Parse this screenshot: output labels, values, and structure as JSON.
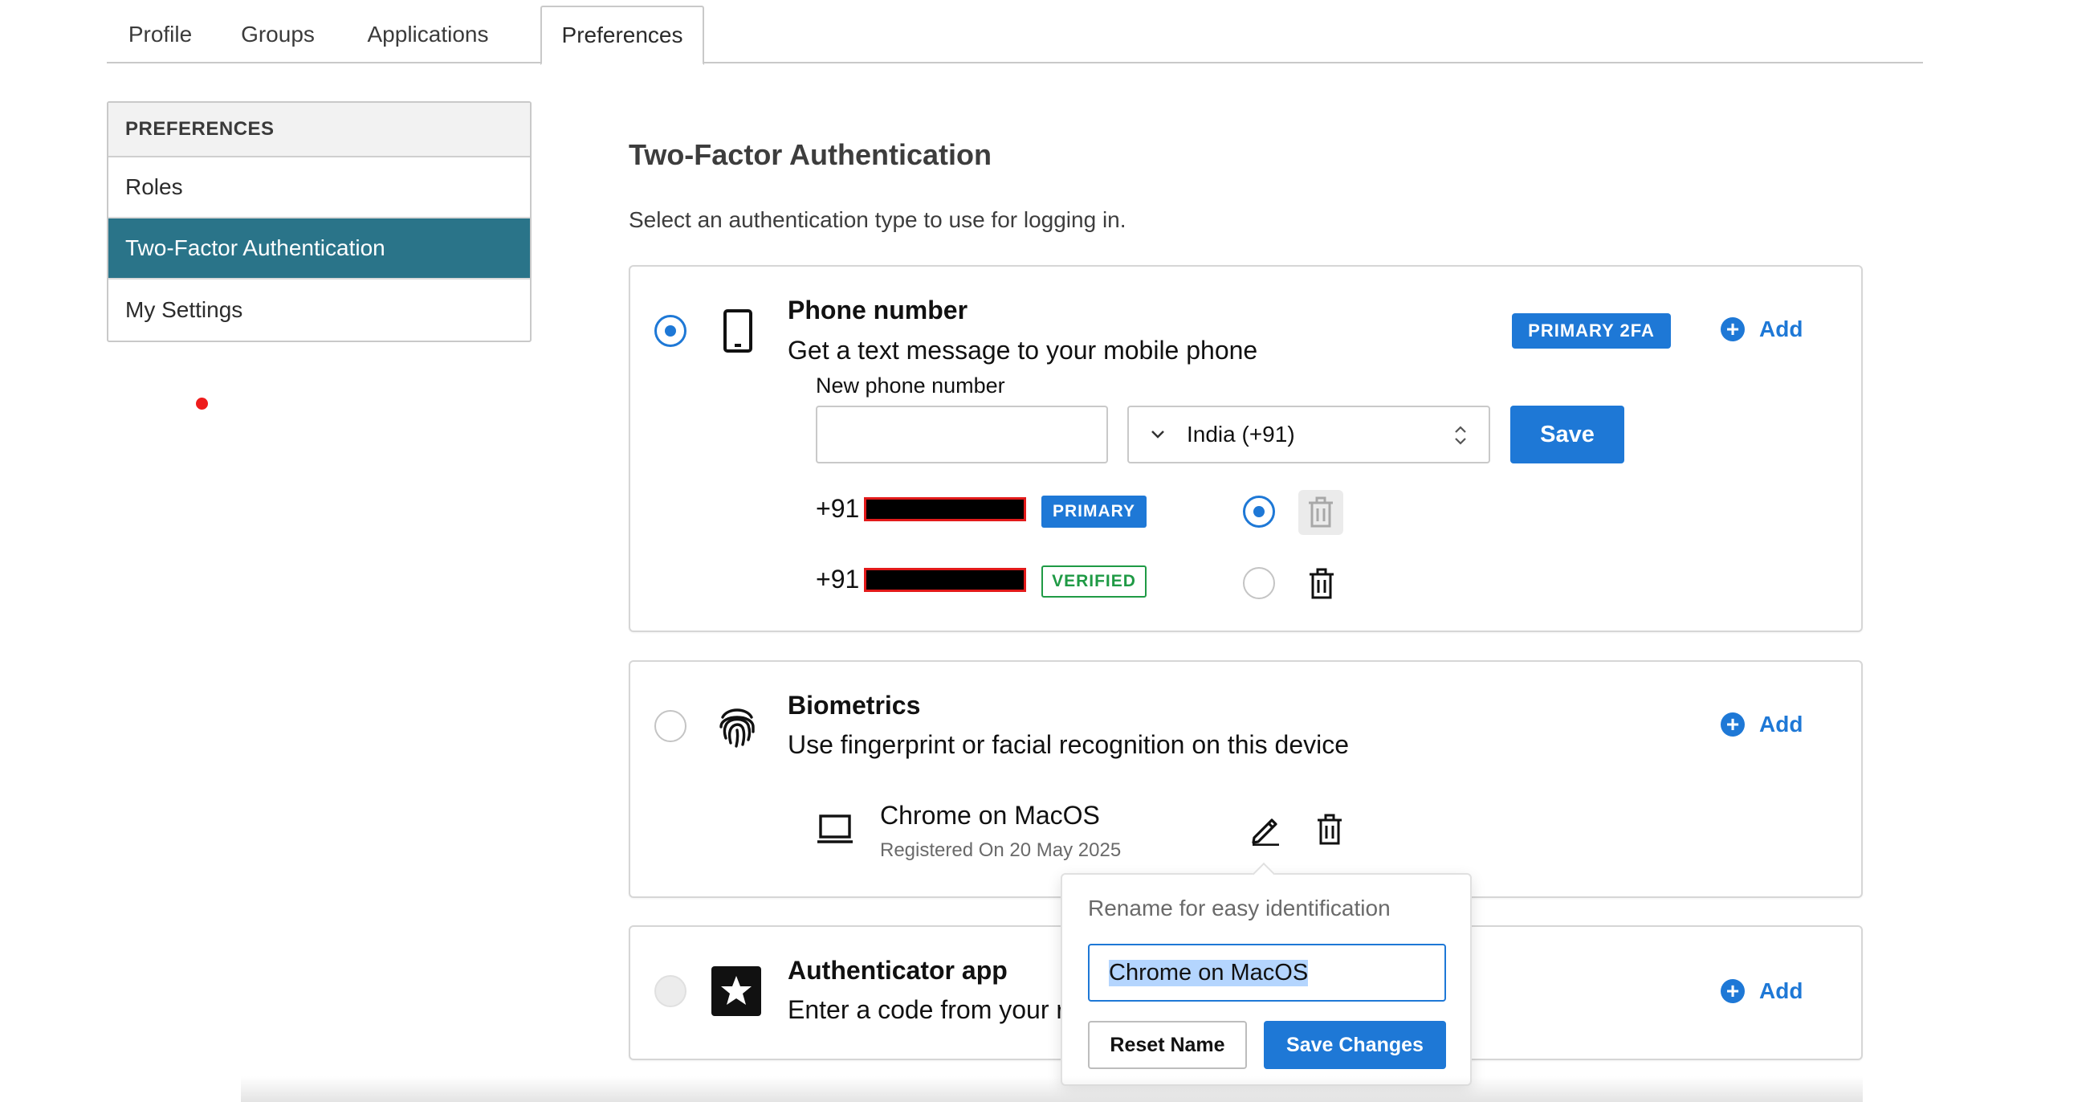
{
  "tabs": [
    {
      "label": "Profile"
    },
    {
      "label": "Groups"
    },
    {
      "label": "Applications"
    },
    {
      "label": "Preferences"
    }
  ],
  "sidebar": {
    "heading": "PREFERENCES",
    "items": [
      {
        "label": "Roles"
      },
      {
        "label": "Two-Factor Authentication"
      },
      {
        "label": "My Settings"
      }
    ]
  },
  "main": {
    "title": "Two-Factor Authentication",
    "subtitle": "Select an authentication type to use for logging in."
  },
  "phone": {
    "title": "Phone number",
    "description": "Get a text message to your mobile phone",
    "badge": "PRIMARY 2FA",
    "add_label": "Add",
    "new_label": "New phone number",
    "input_value": "",
    "country": "India (+91)",
    "save_label": "Save",
    "numbers": [
      {
        "prefix": "+91",
        "badge": "PRIMARY",
        "selected": true
      },
      {
        "prefix": "+91",
        "badge": "VERIFIED",
        "selected": false
      }
    ]
  },
  "biometrics": {
    "title": "Biometrics",
    "description": "Use fingerprint or facial recognition on this device",
    "add_label": "Add",
    "device_name": "Chrome on MacOS",
    "registered": "Registered On 20 May 2025"
  },
  "authenticator": {
    "title": "Authenticator app",
    "description": "Enter a code from your r",
    "add_label": "Add"
  },
  "rename_popover": {
    "label": "Rename for easy identification",
    "input_value": "Chrome on MacOS",
    "reset_label": "Reset Name",
    "save_label": "Save Changes"
  },
  "colors": {
    "accent": "#1e78d6",
    "sidebar_active": "#2a7489",
    "verified": "#1f9a45"
  }
}
